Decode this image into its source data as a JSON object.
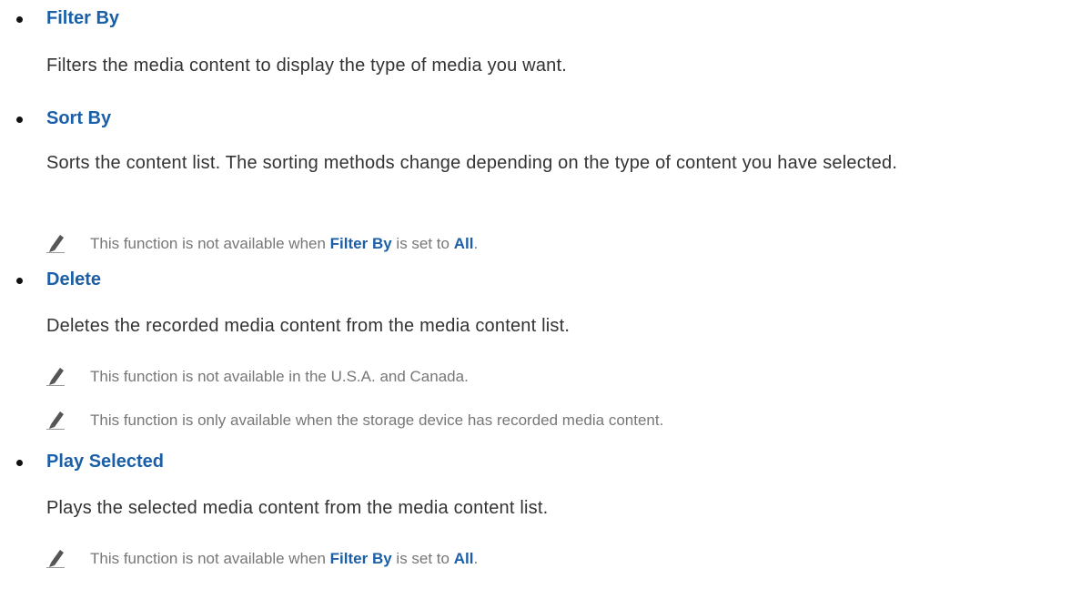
{
  "items": [
    {
      "title": "Filter By",
      "description": "Filters the media content to display the type of media you want."
    },
    {
      "title": "Sort By",
      "description": "Sorts the content list. The sorting methods change depending on the type of content you have selected.",
      "notes": [
        {
          "prefix": "This function is not available when ",
          "hl1": "Filter By",
          "middle": " is set to ",
          "hl2": "All",
          "suffix": "."
        }
      ]
    },
    {
      "title": "Delete",
      "description": "Deletes the recorded media content from the media content list.",
      "notes": [
        {
          "text": "This function is not available in the U.S.A. and Canada."
        },
        {
          "text": "This function is only available when the storage device has recorded media content."
        }
      ]
    },
    {
      "title": "Play Selected",
      "description": "Plays the selected media content from the media content list.",
      "notes": [
        {
          "prefix": "This function is not available when ",
          "hl1": "Filter By",
          "middle": " is set to ",
          "hl2": "All",
          "suffix": "."
        }
      ]
    }
  ],
  "colors": {
    "heading": "#1a5fa8",
    "body_text": "#333333",
    "note_text": "#777777",
    "bullet": "#111111"
  },
  "icons": {
    "note_icon": "pencil-icon",
    "list_marker": "bullet"
  }
}
